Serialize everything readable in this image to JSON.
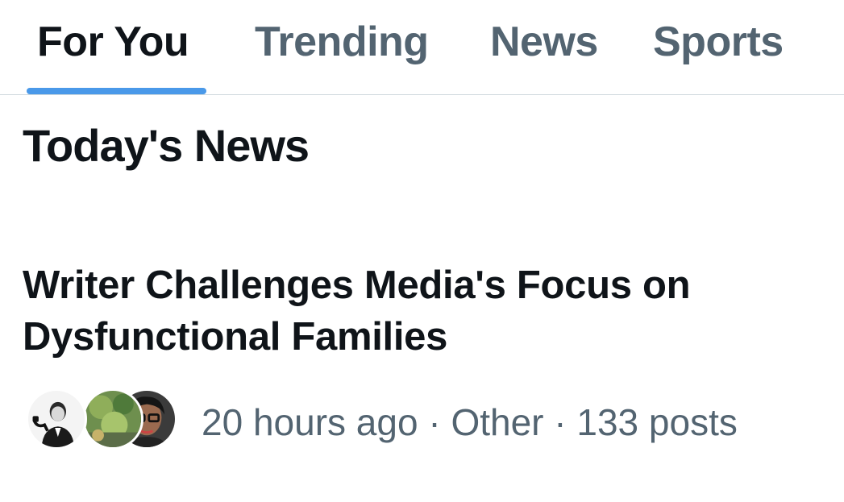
{
  "tabs": [
    {
      "label": "For You",
      "active": true
    },
    {
      "label": "Trending",
      "active": false
    },
    {
      "label": "News",
      "active": false
    },
    {
      "label": "Sports",
      "active": false
    }
  ],
  "section": {
    "title": "Today's News"
  },
  "story": {
    "headline": "Writer Challenges Media's Focus on Dysfunctional Families",
    "time": "20 hours ago",
    "separator": "·",
    "category": "Other",
    "posts": "133 posts"
  },
  "colors": {
    "text_primary": "#0f1419",
    "text_secondary": "#536471",
    "accent": "#4a99e9",
    "divider": "#cfd9de"
  }
}
